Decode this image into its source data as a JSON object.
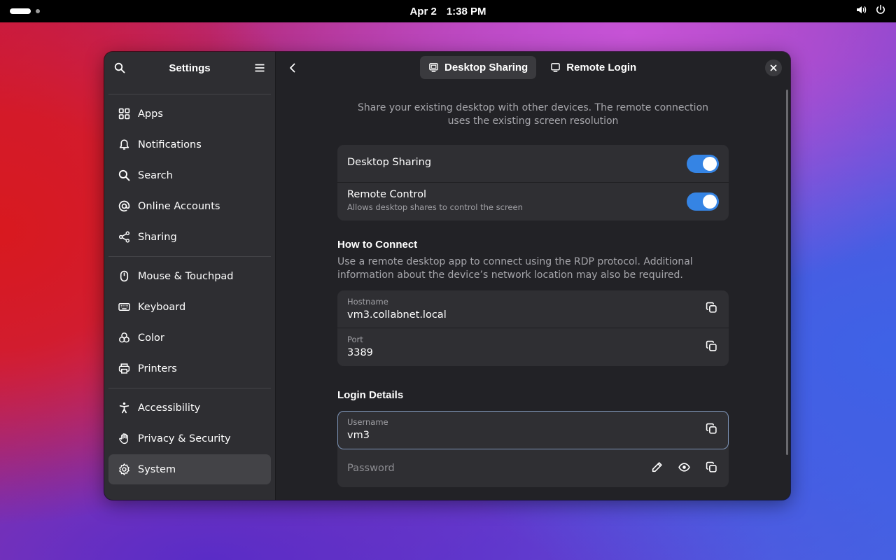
{
  "topbar": {
    "date": "Apr 2",
    "time": "1:38 PM",
    "icons": [
      "volume-icon",
      "power-icon"
    ]
  },
  "sidebar": {
    "title": "Settings",
    "groups": [
      [
        {
          "label": "Apps",
          "icon": "apps-grid-icon"
        },
        {
          "label": "Notifications",
          "icon": "bell-icon"
        },
        {
          "label": "Search",
          "icon": "search-icon"
        },
        {
          "label": "Online Accounts",
          "icon": "at-sign-icon"
        },
        {
          "label": "Sharing",
          "icon": "share-icon"
        }
      ],
      [
        {
          "label": "Mouse & Touchpad",
          "icon": "mouse-icon"
        },
        {
          "label": "Keyboard",
          "icon": "keyboard-icon"
        },
        {
          "label": "Color",
          "icon": "color-icon"
        },
        {
          "label": "Printers",
          "icon": "printer-icon"
        }
      ],
      [
        {
          "label": "Accessibility",
          "icon": "accessibility-icon"
        },
        {
          "label": "Privacy & Security",
          "icon": "hand-icon"
        },
        {
          "label": "System",
          "icon": "gear-icon",
          "selected": true
        }
      ]
    ]
  },
  "main": {
    "tabs": [
      {
        "label": "Desktop Sharing",
        "icon": "desktop-sharing-icon",
        "active": true
      },
      {
        "label": "Remote Login",
        "icon": "monitor-icon",
        "active": false
      }
    ],
    "intro": "Share your existing desktop with other devices. The remote connection uses the existing screen resolution",
    "toggles": [
      {
        "title": "Desktop Sharing",
        "subtitle": "",
        "on": true
      },
      {
        "title": "Remote Control",
        "subtitle": "Allows desktop shares to control the screen",
        "on": true
      }
    ],
    "how_to_connect": {
      "title": "How to Connect",
      "description": "Use a remote desktop app to connect using the RDP protocol. Additional information about the device’s network location may also be required.",
      "hostname_label": "Hostname",
      "hostname_value": "vm3.collabnet.local",
      "port_label": "Port",
      "port_value": "3389"
    },
    "login_details": {
      "title": "Login Details",
      "username_label": "Username",
      "username_value": "vm3",
      "password_placeholder": "Password"
    }
  },
  "colors": {
    "accent": "#3584e4",
    "window_bg": "#222226",
    "sidebar_bg": "#2e2e32",
    "card_bg": "#2f2f33"
  }
}
